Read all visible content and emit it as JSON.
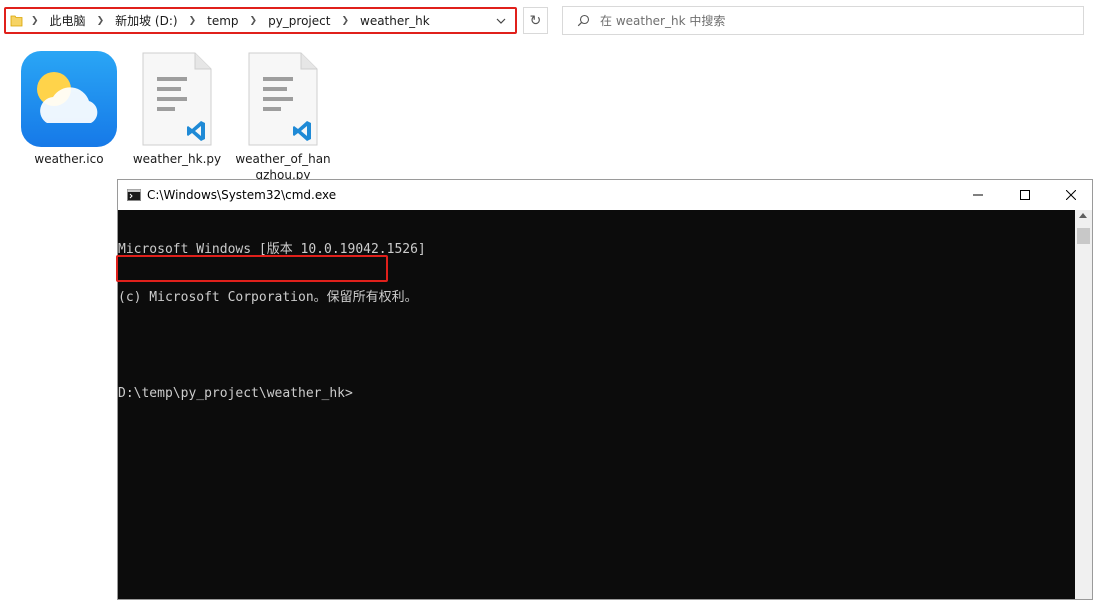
{
  "explorer": {
    "breadcrumb": [
      "此电脑",
      "新加坡 (D:)",
      "temp",
      "py_project",
      "weather_hk"
    ],
    "search_placeholder": "在 weather_hk 中搜索",
    "files": [
      {
        "name": "weather.ico",
        "icon": "weather-icon"
      },
      {
        "name": "weather_hk.py",
        "icon": "vscode-python-file-icon"
      },
      {
        "name_line1": "weather_of_han",
        "name_line2": "gzhou.py",
        "icon": "vscode-python-file-icon"
      }
    ]
  },
  "cmd": {
    "title": "C:\\Windows\\System32\\cmd.exe",
    "lines": [
      "Microsoft Windows [版本 10.0.19042.1526]",
      "(c) Microsoft Corporation。保留所有权利。",
      "",
      "D:\\temp\\py_project\\weather_hk>"
    ]
  },
  "colors": {
    "highlight": "#e0201b",
    "console_bg": "#0c0c0c",
    "console_text": "#cccccc"
  }
}
